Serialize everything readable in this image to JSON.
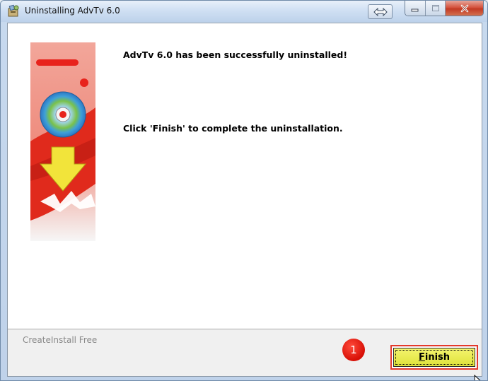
{
  "window": {
    "title": "Uninstalling AdvTv 6.0"
  },
  "content": {
    "message_success": "AdvTv 6.0 has been successfully uninstalled!",
    "message_instruction": "Click 'Finish' to complete the uninstallation."
  },
  "footer": {
    "installer_label": "CreateInstall Free"
  },
  "buttons": {
    "finish_accel": "F",
    "finish_rest": "inish"
  },
  "annotation": {
    "step_number": "1",
    "color": "#e3392b"
  },
  "icons": {
    "app": "installer-icon",
    "resize": "resize-arrows-icon",
    "minimize": "minimize-icon",
    "maximize": "maximize-icon",
    "close": "close-icon",
    "banner": "uninstall-disc-banner",
    "cursor": "mouse-pointer-icon"
  }
}
